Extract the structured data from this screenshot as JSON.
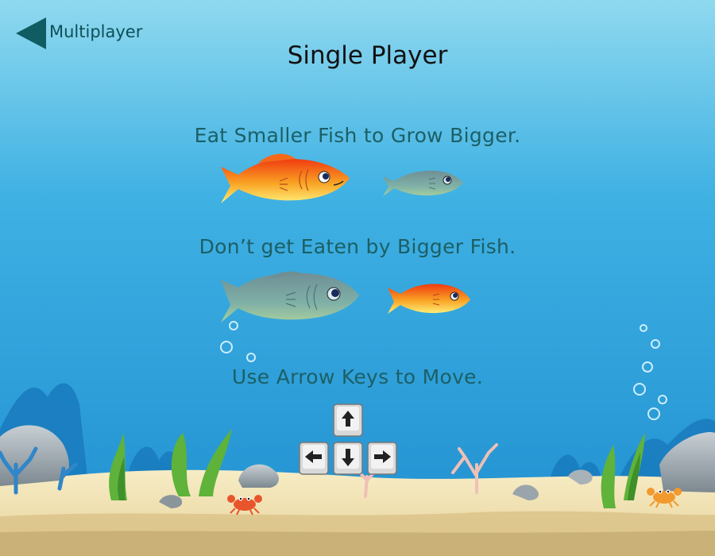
{
  "nav": {
    "back_label": "Multiplayer"
  },
  "screen": {
    "title": "Single Player"
  },
  "instructions": [
    "Eat Smaller Fish to Grow Bigger.",
    "Don’t get Eaten by Bigger Fish.",
    "Use Arrow Keys to Move."
  ],
  "keys": [
    "arrow-up",
    "arrow-left",
    "arrow-down",
    "arrow-right"
  ],
  "colors": {
    "sky_top": "#7fd0ec",
    "water": "#2a9bd6",
    "sand": "#f1e3b3",
    "text_primary": "#1c5f66",
    "player_fish": "#f46a1e",
    "enemy_fish": "#6ea6a4"
  }
}
